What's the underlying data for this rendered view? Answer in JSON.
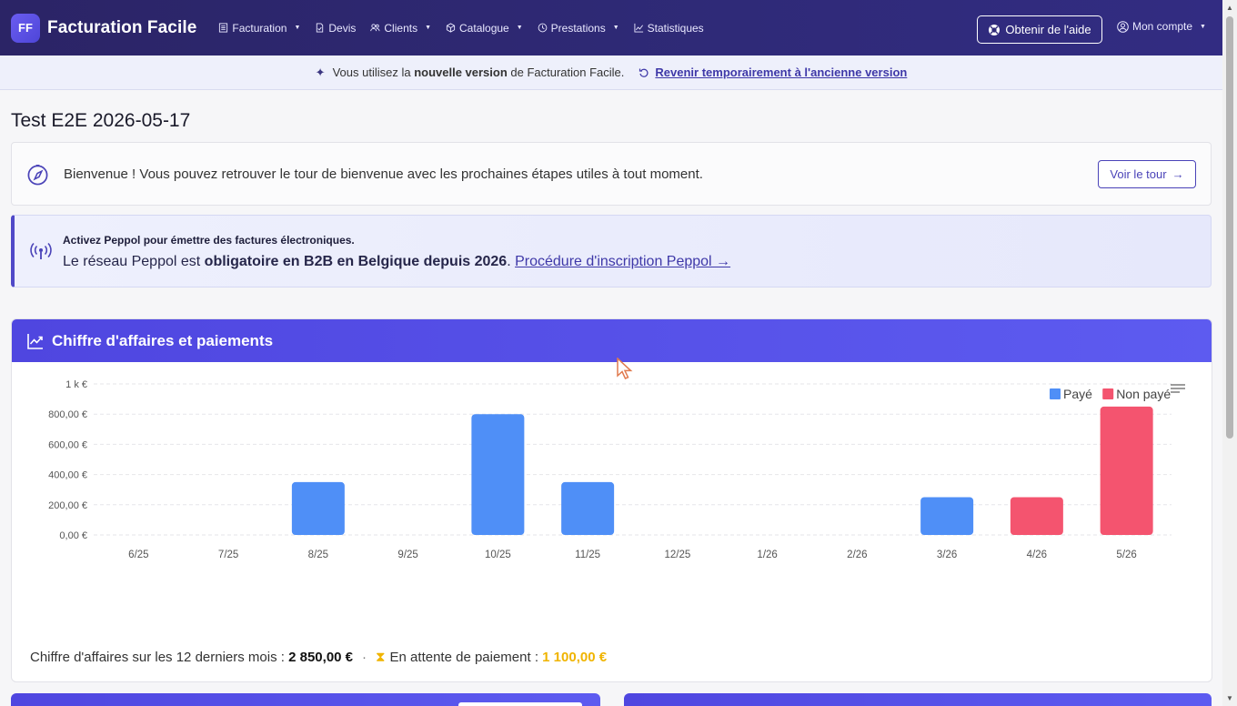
{
  "brand": {
    "logo": "FF",
    "name": "Facturation Facile"
  },
  "nav": {
    "items": [
      {
        "label": "Facturation",
        "icon": "invoice-icon",
        "dropdown": true
      },
      {
        "label": "Devis",
        "icon": "document-icon",
        "dropdown": false
      },
      {
        "label": "Clients",
        "icon": "users-icon",
        "dropdown": true
      },
      {
        "label": "Catalogue",
        "icon": "box-icon",
        "dropdown": true
      },
      {
        "label": "Prestations",
        "icon": "clock-icon",
        "dropdown": true
      },
      {
        "label": "Statistiques",
        "icon": "chart-icon",
        "dropdown": false
      }
    ],
    "help": "Obtenir de l'aide",
    "account": "Mon compte"
  },
  "banner": {
    "prefix": "Vous utilisez la ",
    "bold": "nouvelle version",
    "suffix": " de Facturation Facile.",
    "revert_link": "Revenir temporairement à l'ancienne version"
  },
  "page_title": "Test E2E 2026-05-17",
  "welcome": {
    "text": "Bienvenue ! Vous pouvez retrouver le tour de bienvenue avec les prochaines étapes utiles à tout moment.",
    "button": "Voir le tour"
  },
  "peppol": {
    "title": "Activez Peppol pour émettre des factures électroniques.",
    "text_prefix": "Le réseau Peppol est ",
    "text_bold": "obligatoire en B2B en Belgique depuis 2026",
    "text_sep": ". ",
    "link": "Procédure d'inscription Peppol →"
  },
  "chart_card": {
    "title": "Chiffre d'affaires et paiements"
  },
  "chart_data": {
    "type": "bar",
    "categories": [
      "6/25",
      "7/25",
      "8/25",
      "9/25",
      "10/25",
      "11/25",
      "12/25",
      "1/26",
      "2/26",
      "3/26",
      "4/26",
      "5/26"
    ],
    "series": [
      {
        "name": "Payé",
        "color": "#4f8ff7",
        "values": [
          0,
          0,
          350,
          0,
          800,
          350,
          0,
          0,
          0,
          250,
          0,
          0
        ]
      },
      {
        "name": "Non payé",
        "color": "#f4546f",
        "values": [
          0,
          0,
          0,
          0,
          0,
          0,
          0,
          0,
          0,
          0,
          250,
          850
        ]
      }
    ],
    "y_ticks": [
      "0,00 €",
      "200,00 €",
      "400,00 €",
      "600,00 €",
      "800,00 €",
      "1 k €"
    ],
    "ylim": [
      0,
      1000
    ],
    "stacked": true,
    "grid": true,
    "legend_position": "top-right"
  },
  "summary": {
    "revenue_label": "Chiffre d'affaires sur les 12 derniers mois : ",
    "revenue_value": "2 850,00 €",
    "separator": "·",
    "pending_label": "En attente de paiement : ",
    "pending_value": "1 100,00 €"
  }
}
